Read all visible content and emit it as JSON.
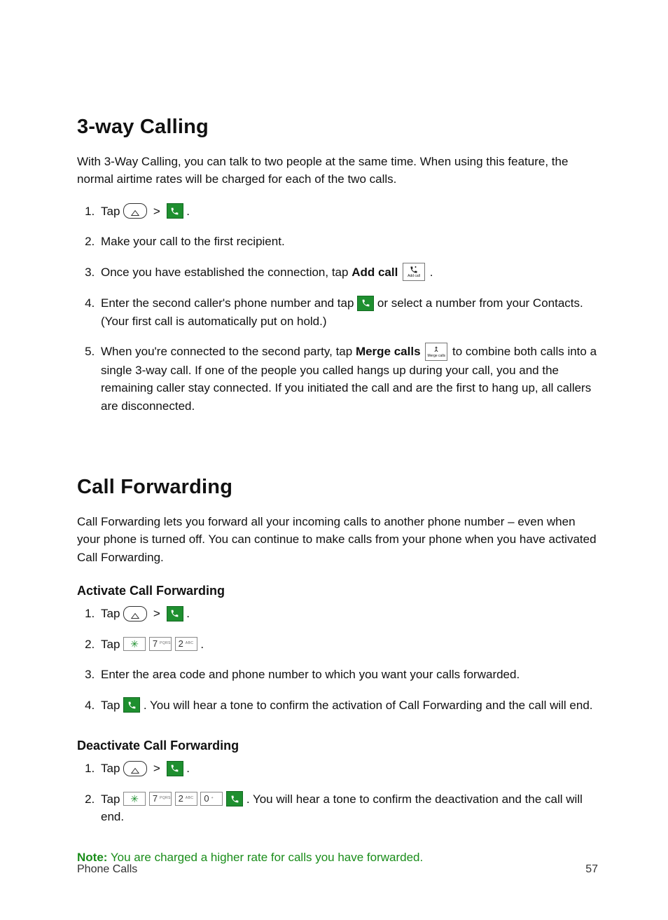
{
  "section1": {
    "title": "3-way Calling",
    "intro": "With 3-Way Calling, you can talk to two people at the same time. When using this feature, the normal airtime rates will be charged for each of the two calls.",
    "steps": {
      "s1_a": "Tap ",
      "s1_b": ".",
      "s2": "Make your call to the first recipient.",
      "s3_a": "Once you have established the connection, tap ",
      "s3_bold": "Add call",
      "s3_b": ".",
      "s4_a": "Enter the second caller's phone number and tap ",
      "s4_b": " or select a number from your Contacts. (Your first call is automatically put on hold.)",
      "s5_a": "When you're connected to the second party, tap ",
      "s5_bold": "Merge calls",
      "s5_b": " to combine both calls into a single 3-way call. If one of the people you called hangs up during your call, you and the remaining caller stay connected. If you initiated the call and are the first to hang up, all callers are disconnected."
    }
  },
  "section2": {
    "title": "Call Forwarding",
    "intro": "Call Forwarding lets you forward all your incoming calls to another phone number – even when your phone is turned off. You can continue to make calls from your phone when you have activated Call Forwarding.",
    "activate_title": "Activate Call Forwarding",
    "activate_steps": {
      "s1_a": "Tap ",
      "s1_b": ".",
      "s2_a": "Tap ",
      "s2_b": ".",
      "s3": "Enter the area code and phone number to which you want your calls forwarded.",
      "s4_a": "Tap ",
      "s4_b": ". You will hear a tone to confirm the activation of Call Forwarding and the call will end."
    },
    "deactivate_title": "Deactivate Call Forwarding",
    "deactivate_steps": {
      "s1_a": "Tap ",
      "s1_b": ".",
      "s2_a": "Tap ",
      "s2_b": ". You will hear a tone to confirm the deactivation and the call will end."
    },
    "note_label": "Note:",
    "note_text": " You are charged a higher rate for calls you have forwarded."
  },
  "footer": {
    "left": "Phone Calls",
    "right": "57"
  },
  "glyphs": {
    "gt": ">",
    "star": "✳",
    "addcall_label": "Add call",
    "merge_label": "Merge calls"
  },
  "keys": {
    "k7": "7",
    "k7s": "PQRS",
    "k2": "2",
    "k2s": "ABC",
    "k0": "0",
    "k0s": "+"
  }
}
